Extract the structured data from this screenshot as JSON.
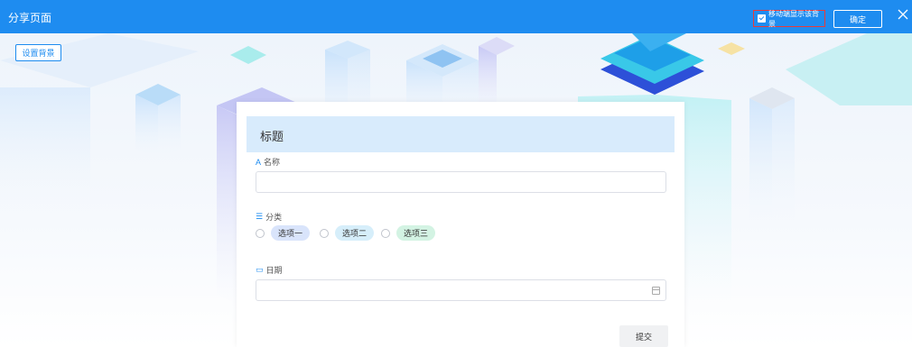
{
  "header": {
    "title": "分享页面",
    "mobile_bg_label": "移动端显示该背景",
    "mobile_bg_checked": true,
    "confirm_label": "确定"
  },
  "toolbar": {
    "set_bg_label": "设置背景"
  },
  "form": {
    "title": "标题",
    "fields": [
      {
        "icon": "text-icon",
        "label": "名称",
        "type": "text",
        "value": ""
      },
      {
        "icon": "list-icon",
        "label": "分类",
        "type": "radio",
        "options": [
          {
            "label": "选项一",
            "color": "#d9e4fb"
          },
          {
            "label": "选项二",
            "color": "#d6eefa"
          },
          {
            "label": "选项三",
            "color": "#d3f3e3"
          }
        ]
      },
      {
        "icon": "calendar-icon",
        "label": "日期",
        "type": "date",
        "value": ""
      }
    ],
    "submit_label": "提交"
  },
  "colors": {
    "primary": "#1e8cf0",
    "header_bg": "#d8ebfc",
    "highlight_border": "#e83a3a"
  }
}
